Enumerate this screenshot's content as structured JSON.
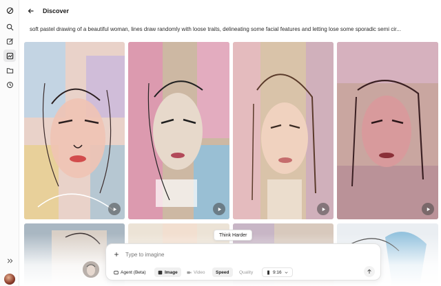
{
  "header": {
    "title": "Discover"
  },
  "prompt_text": "soft pastel drawing of a beautiful woman, lines draw randomly with loose traits, delineating some facial features and letting lose some sporadic semi cir...",
  "sidebar": {
    "items": [
      {
        "icon": "logo-icon"
      },
      {
        "icon": "search-icon"
      },
      {
        "icon": "edit-icon"
      },
      {
        "icon": "discover-icon",
        "active": true
      },
      {
        "icon": "folder-icon"
      },
      {
        "icon": "history-icon"
      }
    ],
    "collapse_icon": "expand-icon"
  },
  "tooltip": "Think Harder",
  "composer": {
    "placeholder": "Type to imagine",
    "options": [
      {
        "label": "Agent (Beta)",
        "icon": "agent-icon",
        "state": "normal"
      },
      {
        "label": "Image",
        "icon": "image-icon",
        "state": "selected"
      },
      {
        "label": "Video",
        "icon": "video-icon",
        "state": "dim"
      },
      {
        "label": "Speed",
        "state": "selected"
      },
      {
        "label": "Quality",
        "state": "dim"
      },
      {
        "label": "9:16",
        "icon": "aspect-icon",
        "state": "normal"
      }
    ]
  },
  "colors": {
    "accent_bg": "#f0f0f0",
    "pastel_pink": "#e98bb2",
    "pastel_blue": "#7fb3d8",
    "pastel_peach": "#f2c2a4"
  }
}
